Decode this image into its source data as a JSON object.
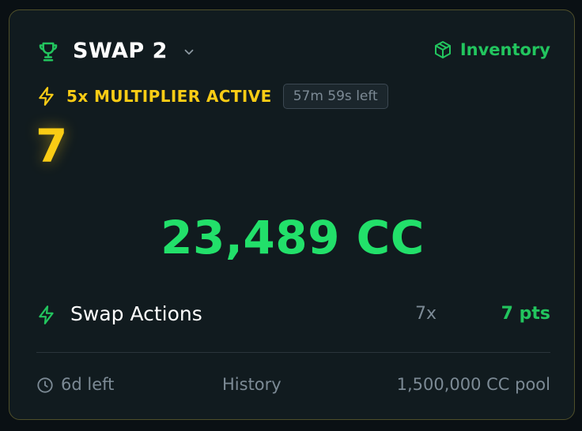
{
  "header": {
    "title": "SWAP 2",
    "inventory_label": "Inventory",
    "title_icon": "trophy-icon",
    "inventory_icon": "box-icon"
  },
  "multiplier": {
    "label": "5x MULTIPLIER ACTIVE",
    "time_left": "57m 59s left",
    "icon": "lightning-icon"
  },
  "streak": {
    "value": "7"
  },
  "balance": {
    "amount": "23,489 CC"
  },
  "actions": {
    "label": "Swap Actions",
    "count": "7x",
    "points": "7 pts"
  },
  "footer": {
    "time_left": "6d left",
    "history_label": "History",
    "pool": "1,500,000 CC pool"
  },
  "colors": {
    "accent_green": "#22c55e",
    "accent_yellow": "#facc15",
    "muted": "#7c8a95",
    "card_bg": "#111b1f"
  }
}
